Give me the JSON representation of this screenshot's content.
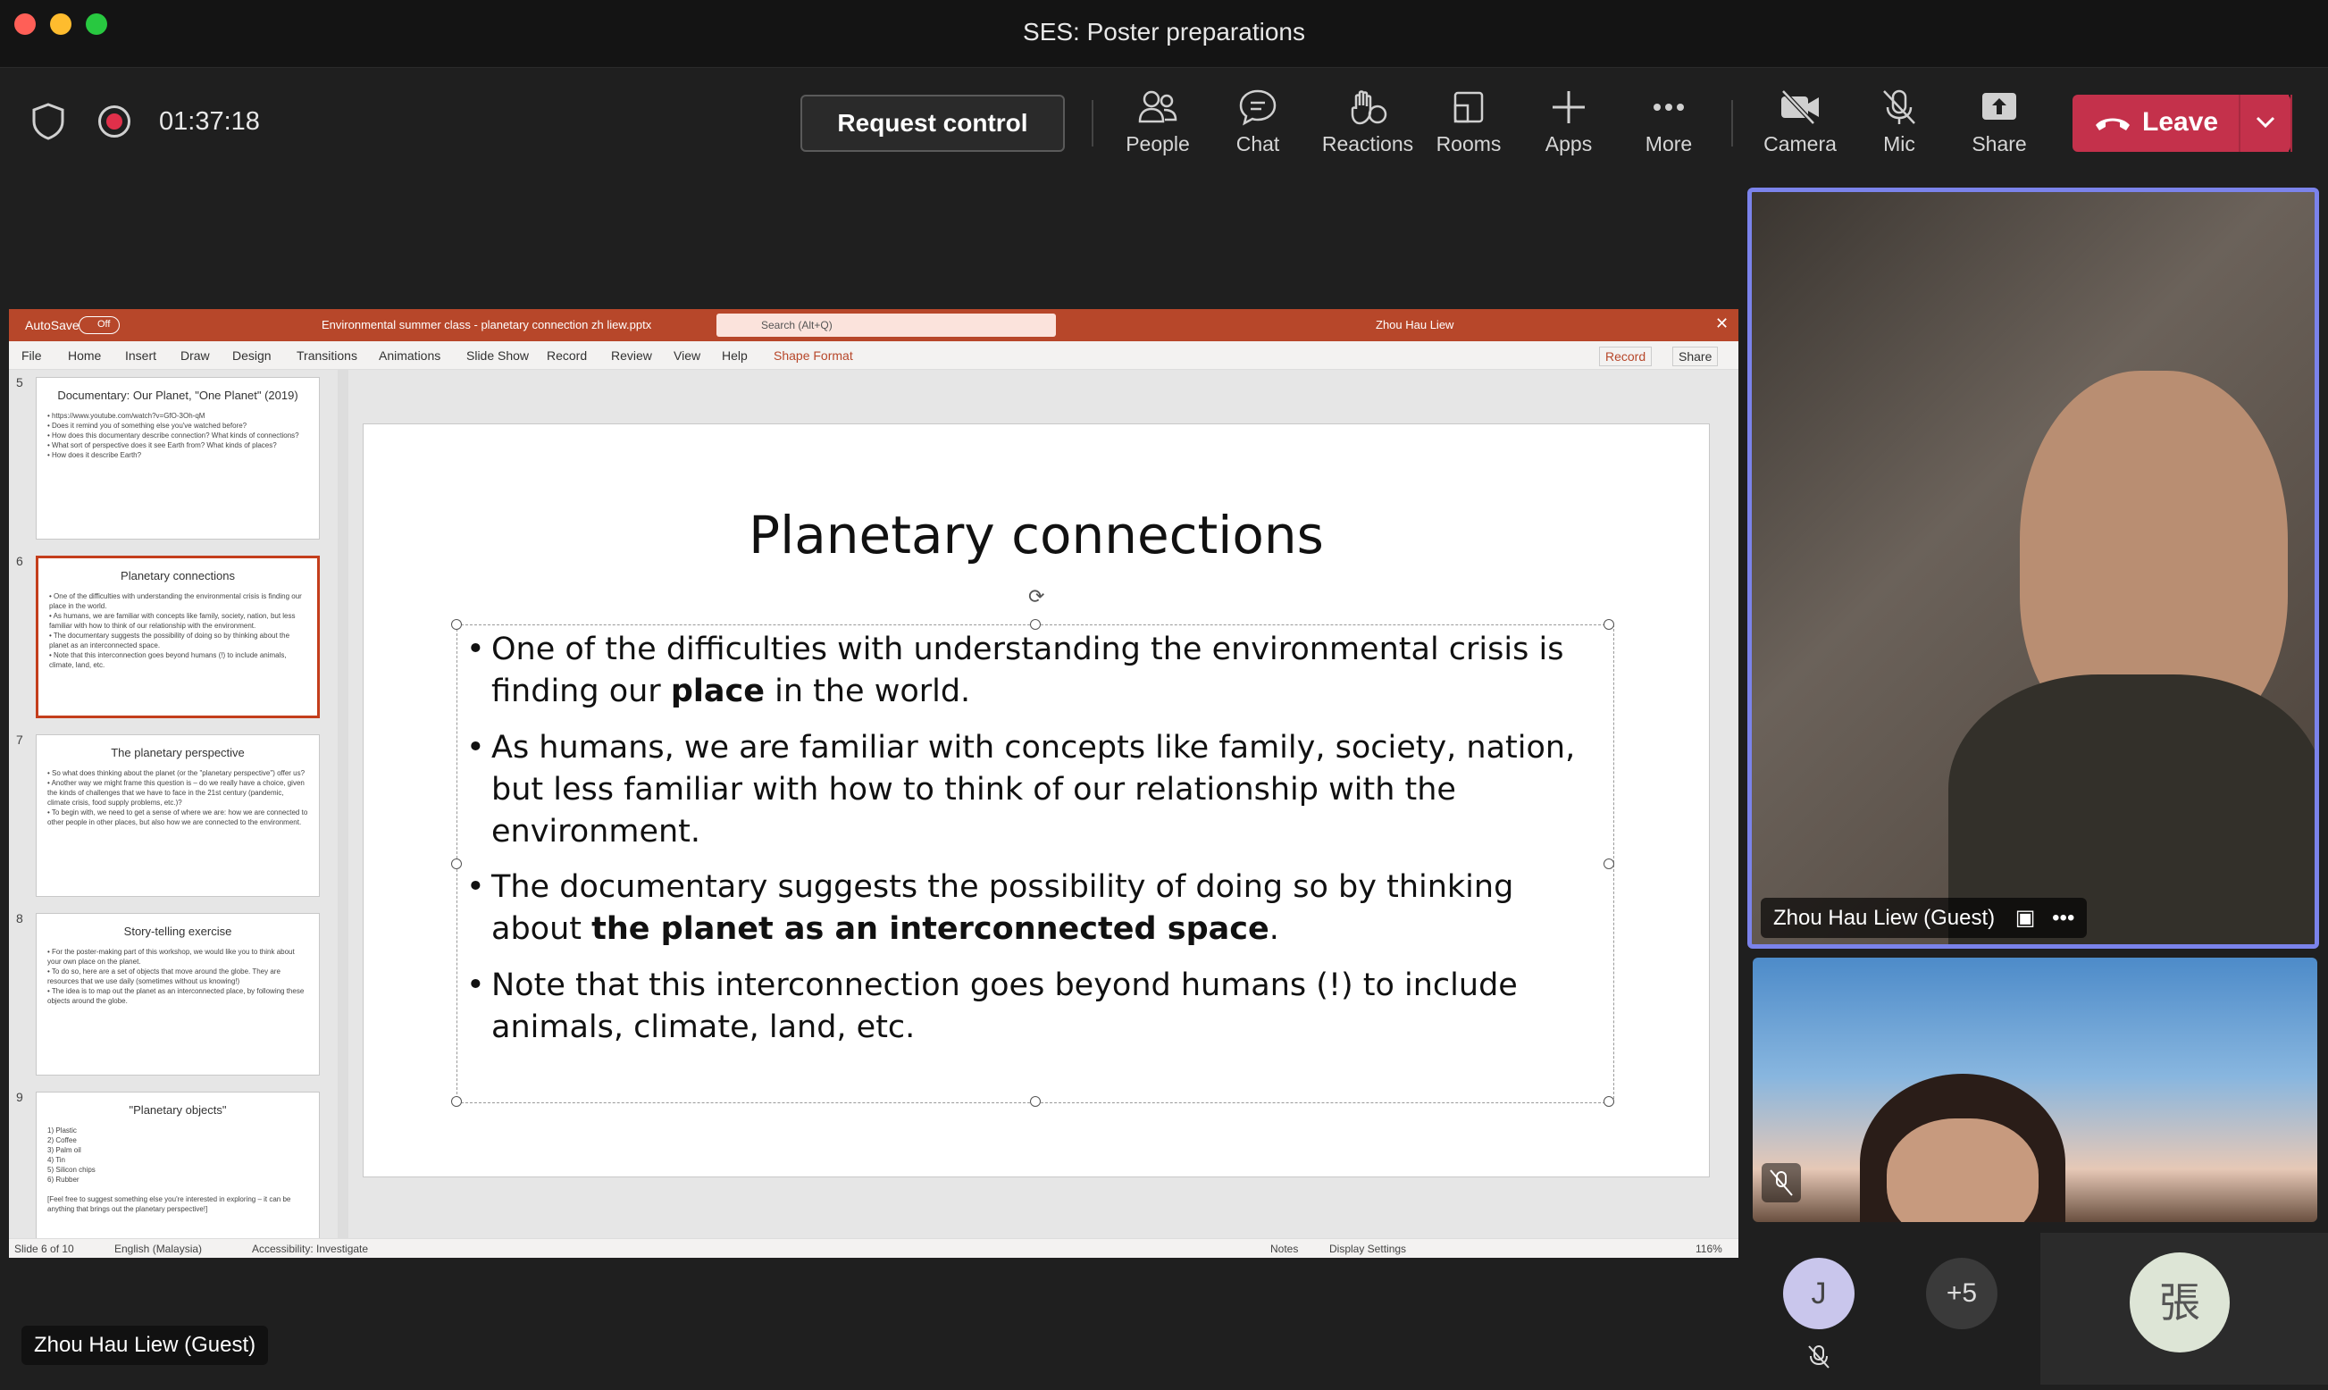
{
  "window": {
    "title": "SES: Poster preparations",
    "traffic_colors": [
      "#ff5f57",
      "#febc2e",
      "#28c840"
    ]
  },
  "toolbar": {
    "timer": "01:37:18",
    "request_control": "Request control",
    "items": [
      {
        "label": "People",
        "icon": "people-icon"
      },
      {
        "label": "Chat",
        "icon": "chat-icon"
      },
      {
        "label": "Reactions",
        "icon": "reactions-icon"
      },
      {
        "label": "Rooms",
        "icon": "rooms-icon"
      },
      {
        "label": "Apps",
        "icon": "apps-icon"
      },
      {
        "label": "More",
        "icon": "more-icon"
      },
      {
        "label": "Camera",
        "icon": "camera-off-icon"
      },
      {
        "label": "Mic",
        "icon": "mic-off-icon"
      },
      {
        "label": "Share",
        "icon": "share-icon"
      }
    ],
    "leave": "Leave",
    "leave_color": "#c4314b"
  },
  "ppt": {
    "autosave": "AutoSave",
    "autosave_state": "Off",
    "filename": "Environmental summer class - planetary connection zh liew.pptx",
    "search": "Search (Alt+Q)",
    "user": "Zhou Hau Liew",
    "ribbon": [
      "File",
      "Home",
      "Insert",
      "Draw",
      "Design",
      "Transitions",
      "Animations",
      "Slide Show",
      "Record",
      "Review",
      "View",
      "Help",
      "Shape Format"
    ],
    "record_btn": "Record",
    "share_btn": "Share",
    "accent": "#b7472a",
    "status": {
      "slide": "Slide 6 of 10",
      "language": "English (Malaysia)",
      "accessibility": "Accessibility: Investigate",
      "notes": "Notes",
      "display": "Display Settings",
      "zoom": "116%"
    },
    "thumbnails": [
      {
        "num": "5",
        "title": "Documentary: Our Planet, \"One Planet\" (2019)",
        "body": "• https://www.youtube.com/watch?v=GfO-3Oh-qM\n• Does it remind you of something else you've watched before?\n• How does this documentary describe connection? What kinds of connections?\n• What sort of perspective does it see Earth from? What kinds of places?\n• How does it describe Earth?"
      },
      {
        "num": "6",
        "title": "Planetary connections",
        "body": "• One of the difficulties with understanding the environmental crisis is finding our place in the world.\n• As humans, we are familiar with concepts like family, society, nation, but less familiar with how to think of our relationship with the environment.\n• The documentary suggests the possibility of doing so by thinking about the planet as an interconnected space.\n• Note that this interconnection goes beyond humans (!) to include animals, climate, land, etc."
      },
      {
        "num": "7",
        "title": "The planetary perspective",
        "body": "• So what does thinking about the planet (or the \"planetary perspective\") offer us?\n• Another way we might frame this question is – do we really have a choice, given the kinds of challenges that we have to face in the 21st century (pandemic, climate crisis, food supply problems, etc.)?\n• To begin with, we need to get a sense of where we are: how we are connected to other people in other places, but also how we are connected to the environment."
      },
      {
        "num": "8",
        "title": "Story-telling exercise",
        "body": "• For the poster-making part of this workshop, we would like you to think about your own place on the planet.\n• To do so, here are a set of objects that move around the globe. They are resources that we use daily (sometimes without us knowing!)\n• The idea is to map out the planet as an interconnected place, by following these objects around the globe."
      },
      {
        "num": "9",
        "title": "\"Planetary objects\"",
        "body": "1) Plastic\n2) Coffee\n3) Palm oil\n4) Tin\n5) Silicon chips\n6) Rubber\n\n[Feel free to suggest something else you're interested in exploring – it can be anything that brings out the planetary perspective!]"
      }
    ],
    "slide": {
      "title": "Planetary connections",
      "bullets": [
        {
          "pre": "One of the difficulties with understanding the environmental crisis is finding our ",
          "bold": "place",
          "post": " in the world."
        },
        {
          "pre": "As humans, we are familiar with concepts like family, society, nation, but less familiar with how to think of our relationship with the environment.",
          "bold": "",
          "post": ""
        },
        {
          "pre": "The documentary suggests the possibility of doing so by thinking about ",
          "bold": "the planet as an interconnected space",
          "post": "."
        },
        {
          "pre": "Note that this interconnection goes beyond humans (!) to include animals, climate, land, etc.",
          "bold": "",
          "post": ""
        }
      ]
    }
  },
  "presenter_tag": "Zhou Hau Liew (Guest)",
  "participants": {
    "main_name": "Zhou Hau Liew (Guest)",
    "avatar_j": "J",
    "more_count": "+5",
    "avatar_cjk": "張"
  }
}
